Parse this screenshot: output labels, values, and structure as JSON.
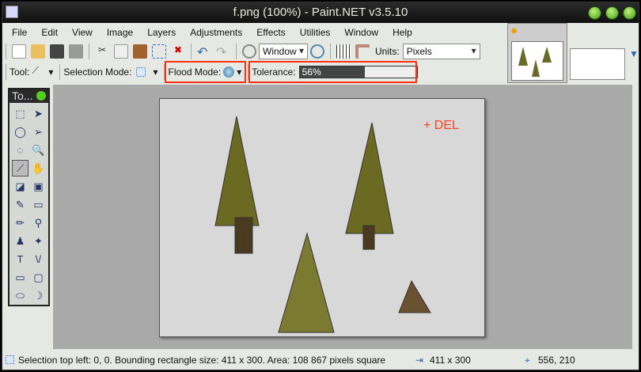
{
  "window": {
    "title": "f.png (100%) - Paint.NET v3.5.10"
  },
  "menu": [
    "File",
    "Edit",
    "View",
    "Image",
    "Layers",
    "Adjustments",
    "Effects",
    "Utilities",
    "Window",
    "Help"
  ],
  "toolbar": {
    "zoom_select": "Window",
    "units_label": "Units:",
    "units_select": "Pixels"
  },
  "toolopts": {
    "tool_label": "Tool:",
    "selection_mode_label": "Selection Mode:",
    "flood_mode_label": "Flood Mode:",
    "tolerance_label": "Tolerance:",
    "tolerance_value": "56%",
    "tolerance_percent": 56
  },
  "tools_panel": {
    "title": "To..."
  },
  "canvas": {
    "annotation": "+ DEL"
  },
  "status": {
    "message": "Selection top left: 0, 0. Bounding rectangle size: 411 x 300. Area: 108 867 pixels square",
    "image_size": "411 x 300",
    "cursor": "556, 210"
  },
  "colors": {
    "highlight": "#ff3010",
    "annotation": "#ff4020"
  }
}
